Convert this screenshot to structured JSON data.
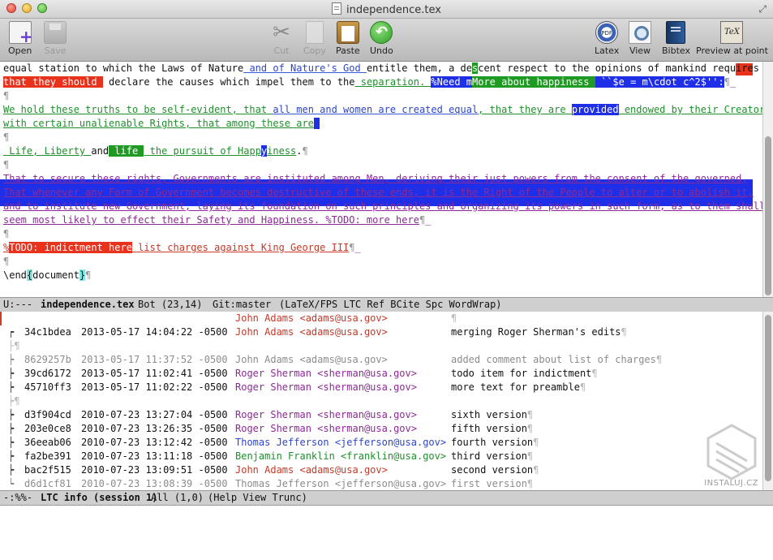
{
  "window": {
    "title": "independence.tex"
  },
  "toolbar": {
    "open": "Open",
    "save": "Save",
    "cut": "Cut",
    "copy": "Copy",
    "paste": "Paste",
    "undo": "Undo",
    "latex": "Latex",
    "view": "View",
    "bibtex": "Bibtex",
    "preview": "Preview at point",
    "latex_icon_text": "PDF",
    "preview_icon_text": "TeX"
  },
  "editor": {
    "l1": [
      "equal station to which the Laws of Nature",
      " and of Nature's God ",
      "entitle them, a de",
      "s",
      "cent respect to the opinions of mankind requires"
    ],
    "l2": [
      "that they should ",
      " declare the causes which impel them to the",
      " separation. ",
      "%Need m",
      "More about ",
      "happiness ",
      " ``$e = m\\cdot c^2$'':",
      "¶",
      "_"
    ],
    "l3": "¶",
    "l4": [
      "We hold these truths to be self-evident, that ",
      "all men and women are created equal",
      ", that they are ",
      "provided",
      " endowed by their Creator"
    ],
    "l5": [
      "with certain unalienable Rights, that among these are",
      " "
    ],
    "l6": "¶",
    "l7": [
      " Life, Liberty ",
      "and",
      " life ",
      " the pursuit of Happ",
      "y",
      "iness",
      ".",
      "¶"
    ],
    "l8": "¶",
    "l9": "That to secure these rights, Governments are instituted among Men, deriving their just powers from the consent of the governed,",
    "l10": "That whenever any Form of Government becomes destructive of these ends, it is the Right of the People to alter or to abolish it,",
    "l11": "and to institute new Government, laying its foundation on such principles and organizing its powers in such form, as to them shall",
    "l12": [
      "seem most likely to effect their Safety and Happiness. %TODO: more here",
      "¶",
      "_"
    ],
    "l13": "¶",
    "l14": [
      "%",
      "TODO: indictment here",
      " list charges against King George III",
      "¶",
      "_"
    ],
    "l15": "¶",
    "l16": [
      "\\end",
      "{",
      "document",
      "}",
      "¶"
    ]
  },
  "modeline_top": {
    "status": "U:---",
    "buffer": "independence.tex",
    "position": "Bot (23,14)",
    "branch": "Git:master",
    "modes": "(LaTeX/FPS LTC Ref BCite Spc WordWrap)"
  },
  "log": {
    "rows": [
      {
        "graph": "",
        "hash": "",
        "date": "",
        "author": "John Adams <adams@usa.gov>",
        "msg": "",
        "pilcrow": "¶"
      },
      {
        "graph": "┍",
        "hash": "34c1bdea",
        "date": "2013-05-17 14:04:22 -0500",
        "author": "John Adams <adams@usa.gov>",
        "msg": "merging Roger Sherman's edits",
        "pilcrow": "¶"
      },
      {
        "graph": "├¶",
        "hash": "",
        "date": "",
        "author": "",
        "msg": "",
        "pilcrow": ""
      },
      {
        "graph": "┝",
        "hash": "8629257b",
        "date": "2013-05-17 11:37:52 -0500",
        "author": "John Adams <adams@usa.gov>",
        "msg": "added comment about list of charges",
        "pilcrow": "¶"
      },
      {
        "graph": "┝",
        "hash": "39cd6172",
        "date": "2013-05-17 11:02:41 -0500",
        "author": "Roger Sherman <sherman@usa.gov>",
        "msg": "todo item for indictment",
        "pilcrow": "¶"
      },
      {
        "graph": "┝",
        "hash": "45710ff3",
        "date": "2013-05-17 11:02:22 -0500",
        "author": "Roger Sherman <sherman@usa.gov>",
        "msg": "more text for preamble",
        "pilcrow": "¶"
      },
      {
        "graph": "┝¶",
        "hash": "",
        "date": "",
        "author": "",
        "msg": "",
        "pilcrow": ""
      },
      {
        "graph": "┝",
        "hash": "d3f904cd",
        "date": "2010-07-23 13:27:04 -0500",
        "author": "Roger Sherman <sherman@usa.gov>",
        "msg": "sixth version",
        "pilcrow": "¶"
      },
      {
        "graph": "┝",
        "hash": "203e0ce8",
        "date": "2010-07-23 13:26:35 -0500",
        "author": "Roger Sherman <sherman@usa.gov>",
        "msg": "fifth version",
        "pilcrow": "¶"
      },
      {
        "graph": "┝",
        "hash": "36eeab06",
        "date": "2010-07-23 13:12:42 -0500",
        "author": "Thomas Jefferson <jefferson@usa.gov>",
        "msg": "fourth version",
        "pilcrow": "¶"
      },
      {
        "graph": "┝",
        "hash": "fa2be391",
        "date": "2010-07-23 13:11:18 -0500",
        "author": "Benjamin Franklin <franklin@usa.gov>",
        "msg": "third version",
        "pilcrow": "¶"
      },
      {
        "graph": "┝",
        "hash": "bac2f515",
        "date": "2010-07-23 13:09:51 -0500",
        "author": "John Adams <adams@usa.gov>",
        "msg": "second version",
        "pilcrow": "¶"
      },
      {
        "graph": "┕",
        "hash": "d6d1cf81",
        "date": "2010-07-23 13:08:39 -0500",
        "author": "Thomas Jefferson <jefferson@usa.gov>",
        "msg": "first version",
        "pilcrow": "¶"
      }
    ]
  },
  "modeline_bottom": {
    "status": "-:%%-",
    "buffer": "LTC info (session 1)",
    "position": "All (1,0)",
    "modes": "(Help View Trunc)"
  },
  "watermark": {
    "text": "INSTALUJ.CZ"
  },
  "colors": {
    "adams": "#c23a2a",
    "sherman": "#8c2a96",
    "jefferson": "#2d46c6",
    "franklin": "#1f8f2c",
    "highlight_red": "#e8321c",
    "highlight_blue": "#1f2fe8",
    "highlight_green": "#1f9a22"
  }
}
